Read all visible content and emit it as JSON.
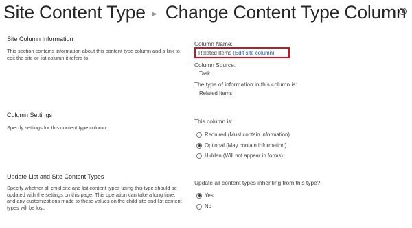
{
  "header": {
    "crumb1": "Site Content Type",
    "separator_icon": "triangle-right-icon",
    "crumb2": "Change Content Type Column",
    "info_icon": "info-icon"
  },
  "site_column_info": {
    "title": "Site Column Information",
    "description": "This section contains information about this content type column and a link to edit the site or list column it refers to.",
    "column_name_label": "Column Name:",
    "column_name_value": "Related Items",
    "edit_link": "(Edit site column)",
    "column_source_label": "Column Source:",
    "column_source_value": "Task",
    "type_label": "The type of information in this column is:",
    "type_value": "Related Items"
  },
  "column_settings": {
    "title": "Column Settings",
    "description": "Specify settings for this content type column.",
    "question": "This column is:",
    "options": [
      {
        "label": "Required (Must contain information)",
        "checked": false
      },
      {
        "label": "Optional (May contain information)",
        "checked": true
      },
      {
        "label": "Hidden (Will not appear in forms)",
        "checked": false
      }
    ]
  },
  "update_section": {
    "title": "Update List and Site Content Types",
    "description": "Specify whether all child site and list content types using this type should be updated with the settings on this page. This operation can take a long time, and any customizations made to these values on the child site and list content types will be lost.",
    "question": "Update all content types inheriting from this type?",
    "options": [
      {
        "label": "Yes",
        "checked": true
      },
      {
        "label": "No",
        "checked": false
      }
    ]
  }
}
